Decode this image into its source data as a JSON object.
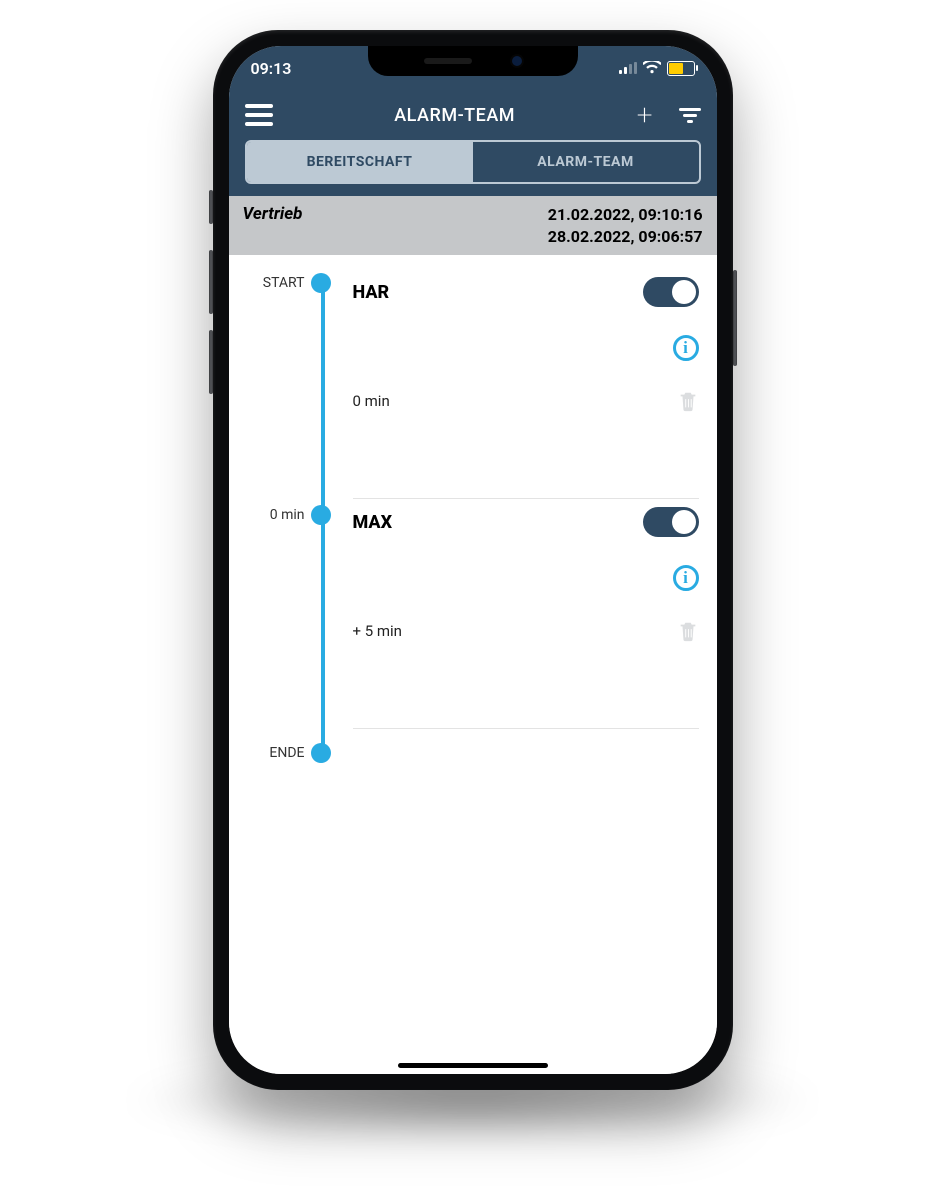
{
  "status_bar": {
    "time": "09:13"
  },
  "nav": {
    "title": "ALARM-TEAM"
  },
  "tabs": {
    "left": "BEREITSCHAFT",
    "right": "ALARM-TEAM"
  },
  "group": {
    "name": "Vertrieb",
    "date_start": "21.02.2022, 09:10:16",
    "date_end": "28.02.2022, 09:06:57"
  },
  "timeline": {
    "start_label": "START",
    "mid_label": "0 min",
    "end_label": "ENDE"
  },
  "items": [
    {
      "name": "HAR",
      "duration": "0 min"
    },
    {
      "name": "MAX",
      "duration": "+ 5 min"
    }
  ]
}
